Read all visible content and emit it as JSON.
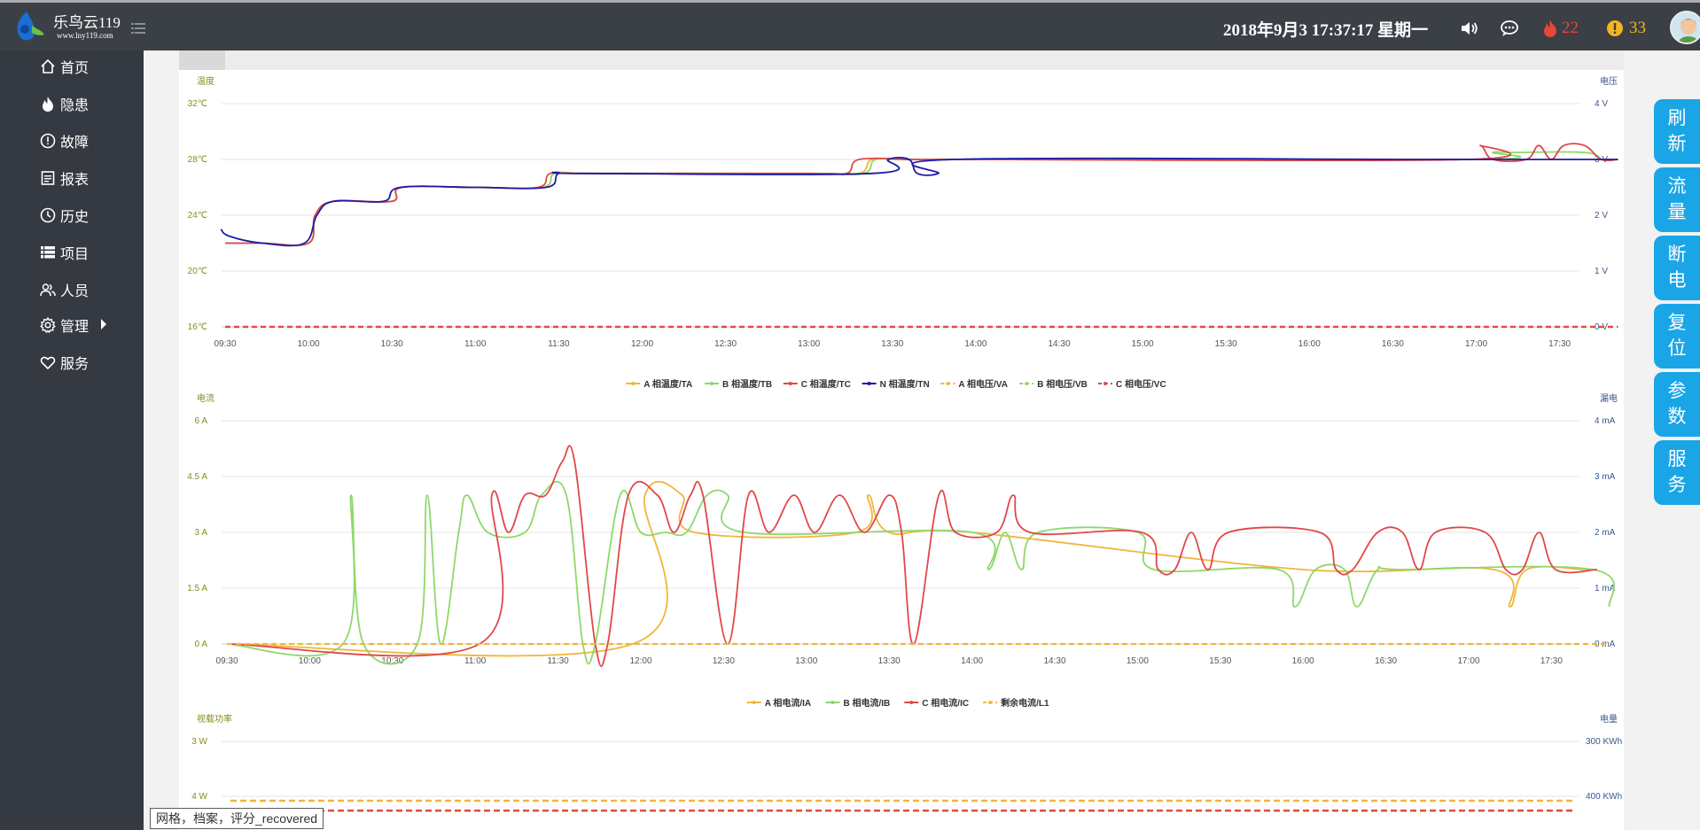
{
  "header": {
    "brand_name": "乐鸟云119",
    "brand_url": "www.lny119.com",
    "datetime": "2018年9月3 17:37:17 星期一",
    "fire_count": "22",
    "warning_count": "33"
  },
  "sidebar": {
    "items": [
      {
        "label": "首页",
        "icon": "home-icon"
      },
      {
        "label": "隐患",
        "icon": "fire-icon"
      },
      {
        "label": "故障",
        "icon": "alert-circle-icon"
      },
      {
        "label": "报表",
        "icon": "report-icon"
      },
      {
        "label": "历史",
        "icon": "clock-icon"
      },
      {
        "label": "项目",
        "icon": "project-icon"
      },
      {
        "label": "人员",
        "icon": "people-icon"
      },
      {
        "label": "管理",
        "icon": "gear-icon"
      },
      {
        "label": "服务",
        "icon": "heart-icon"
      }
    ]
  },
  "actions": [
    {
      "line1": "刷",
      "line2": "新"
    },
    {
      "line1": "流",
      "line2": "量"
    },
    {
      "line1": "断",
      "line2": "电"
    },
    {
      "line1": "复",
      "line2": "位"
    },
    {
      "line1": "参",
      "line2": "数"
    },
    {
      "line1": "服",
      "line2": "务"
    }
  ],
  "tooltip": "网格，档案，评分_recovered",
  "colors": {
    "series_a": "#f0b63a",
    "series_b": "#8fd86a",
    "series_c": "#e04848",
    "series_n": "#1f1aa6",
    "axis_left": "#8a8a20",
    "axis_right": "#3a5a8a",
    "action": "#1aa6e6"
  },
  "chart_data": [
    {
      "type": "line",
      "ylabel": "温度",
      "y2label": "电压",
      "x": [
        "09:30",
        "10:00",
        "10:30",
        "11:00",
        "11:30",
        "12:00",
        "12:30",
        "13:00",
        "13:30",
        "14:00",
        "14:30",
        "15:00",
        "15:30",
        "16:00",
        "16:30",
        "17:00",
        "17:30"
      ],
      "ylim": [
        16,
        32
      ],
      "yticks": [
        "16℃",
        "20℃",
        "24℃",
        "28℃",
        "32℃"
      ],
      "y2lim": [
        0,
        4
      ],
      "y2ticks": [
        "0 V",
        "1 V",
        "2 V",
        "3 V",
        "4 V"
      ],
      "grid": true,
      "legend_position": "bottom",
      "series": [
        {
          "name": "A 相温度/TA",
          "axis": "left",
          "color": "#f0b63a",
          "dash": false,
          "points": [
            [
              0,
              22
            ],
            [
              0.45,
              22
            ],
            [
              1,
              22
            ],
            [
              1.08,
              24
            ],
            [
              1.3,
              25
            ],
            [
              2,
              25
            ],
            [
              2.12,
              26
            ],
            [
              3,
              26
            ],
            [
              3.8,
              26
            ],
            [
              3.95,
              27
            ],
            [
              4.3,
              27
            ],
            [
              4.95,
              27
            ],
            [
              7,
              27
            ],
            [
              7.6,
              27
            ],
            [
              7.75,
              28
            ],
            [
              8.05,
              28
            ],
            [
              8.35,
              28
            ],
            [
              9,
              28
            ],
            [
              15,
              28
            ]
          ]
        },
        {
          "name": "B 相温度/TB",
          "axis": "left",
          "color": "#8fd86a",
          "dash": false,
          "points": [
            [
              0,
              22
            ],
            [
              0.45,
              22
            ],
            [
              1,
              22
            ],
            [
              1.08,
              24
            ],
            [
              1.3,
              25
            ],
            [
              2,
              25
            ],
            [
              2.12,
              26
            ],
            [
              3,
              26
            ],
            [
              3.8,
              26
            ],
            [
              3.95,
              27
            ],
            [
              4.3,
              27
            ],
            [
              7,
              27
            ],
            [
              7.65,
              27
            ],
            [
              7.8,
              28
            ],
            [
              8.2,
              28
            ],
            [
              8.35,
              28
            ],
            [
              9,
              28
            ],
            [
              15,
              28
            ],
            [
              15.2,
              28.5
            ],
            [
              15.45,
              28.5
            ],
            [
              16.3,
              28.5
            ],
            [
              16.5,
              28
            ]
          ]
        },
        {
          "name": "C 相温度/TC",
          "axis": "left",
          "color": "#e04848",
          "dash": false,
          "points": [
            [
              0,
              22
            ],
            [
              0.45,
              22
            ],
            [
              1,
              22
            ],
            [
              1.08,
              24
            ],
            [
              1.3,
              25
            ],
            [
              2,
              25
            ],
            [
              2.12,
              26
            ],
            [
              3,
              26
            ],
            [
              3.75,
              26
            ],
            [
              3.9,
              27
            ],
            [
              4.3,
              27
            ],
            [
              7,
              27
            ],
            [
              7.45,
              27
            ],
            [
              7.6,
              28
            ],
            [
              8.2,
              28
            ],
            [
              8.45,
              28
            ],
            [
              9,
              28
            ],
            [
              14.9,
              28
            ],
            [
              15.05,
              29
            ],
            [
              15.2,
              28
            ],
            [
              15.6,
              28
            ],
            [
              15.75,
              29
            ],
            [
              15.9,
              28
            ],
            [
              16.05,
              29
            ],
            [
              16.3,
              29
            ],
            [
              16.5,
              28
            ],
            [
              16.7,
              28
            ]
          ]
        },
        {
          "name": "N 相温度/TN",
          "axis": "left",
          "color": "#1f1aa6",
          "dash": false,
          "points": [
            [
              -0.05,
              23
            ],
            [
              0.05,
              22.5
            ],
            [
              0.45,
              22
            ],
            [
              0.95,
              22
            ],
            [
              1.1,
              24
            ],
            [
              1.3,
              25
            ],
            [
              1.9,
              25
            ],
            [
              2.1,
              26
            ],
            [
              3,
              26
            ],
            [
              3.85,
              26
            ],
            [
              4,
              27
            ],
            [
              4.3,
              27
            ],
            [
              7.75,
              27
            ],
            [
              7.95,
              28
            ],
            [
              8.2,
              28
            ],
            [
              8.3,
              27
            ],
            [
              8.55,
              27
            ],
            [
              8.75,
              28
            ],
            [
              14.5,
              28
            ],
            [
              16.7,
              28
            ]
          ]
        },
        {
          "name": "A 相电压/VA",
          "axis": "right",
          "color": "#f0b63a",
          "dash": true,
          "points": [
            [
              0,
              0
            ],
            [
              16.7,
              0
            ]
          ]
        },
        {
          "name": "B 相电压/VB",
          "axis": "right",
          "color": "#8fd86a",
          "dash": true,
          "points": [
            [
              0,
              0
            ],
            [
              16.7,
              0
            ]
          ]
        },
        {
          "name": "C 相电压/VC",
          "axis": "right",
          "color": "#e04848",
          "dash": true,
          "points": [
            [
              0,
              0
            ],
            [
              16.7,
              0
            ]
          ]
        }
      ]
    },
    {
      "type": "line",
      "ylabel": "电流",
      "y2label": "漏电",
      "x": [
        "09:30",
        "10:00",
        "10:30",
        "11:00",
        "11:30",
        "12:00",
        "12:30",
        "13:00",
        "13:30",
        "14:00",
        "14:30",
        "15:00",
        "15:30",
        "16:00",
        "16:30",
        "17:00",
        "17:30"
      ],
      "ylim": [
        0,
        6
      ],
      "yticks": [
        "0 A",
        "1.5 A",
        "3 A",
        "4.5 A",
        "6 A"
      ],
      "y2lim": [
        0,
        4
      ],
      "y2ticks": [
        "0 mA",
        "1 mA",
        "2 mA",
        "3 mA",
        "4 mA"
      ],
      "grid": true,
      "legend_position": "bottom",
      "series": [
        {
          "name": "A 相电流/IA",
          "axis": "left",
          "color": "#f0b63a",
          "dash": false,
          "points": [
            [
              0,
              0
            ],
            [
              4.9,
              0
            ],
            [
              5.05,
              4
            ],
            [
              5.5,
              4
            ],
            [
              5.65,
              3
            ],
            [
              7.6,
              3
            ],
            [
              7.75,
              4
            ],
            [
              8,
              3
            ],
            [
              9,
              3
            ],
            [
              13,
              2
            ],
            [
              15.3,
              2
            ],
            [
              15.5,
              1
            ],
            [
              15.7,
              2
            ],
            [
              16.4,
              2
            ],
            [
              16.55,
              2
            ]
          ]
        },
        {
          "name": "B 相电流/IB",
          "axis": "left",
          "color": "#8fd86a",
          "dash": false,
          "points": [
            [
              0,
              0
            ],
            [
              1.4,
              0
            ],
            [
              1.5,
              4
            ],
            [
              1.65,
              0
            ],
            [
              2.3,
              0
            ],
            [
              2.42,
              4
            ],
            [
              2.58,
              0
            ],
            [
              2.8,
              3
            ],
            [
              2.9,
              4
            ],
            [
              3.15,
              3
            ],
            [
              3.6,
              3
            ],
            [
              3.8,
              4
            ],
            [
              4.1,
              4
            ],
            [
              4.3,
              0
            ],
            [
              4.45,
              0
            ],
            [
              4.75,
              4
            ],
            [
              5,
              3
            ],
            [
              5.3,
              3
            ],
            [
              5.55,
              3
            ],
            [
              5.8,
              4
            ],
            [
              6.05,
              4
            ],
            [
              6.25,
              3
            ],
            [
              9,
              3
            ],
            [
              9.2,
              2
            ],
            [
              9.4,
              3
            ],
            [
              9.6,
              2
            ],
            [
              9.8,
              3
            ],
            [
              11,
              3
            ],
            [
              11.2,
              2
            ],
            [
              12.7,
              2
            ],
            [
              12.9,
              1
            ],
            [
              13.15,
              2
            ],
            [
              13.5,
              2
            ],
            [
              13.65,
              1
            ],
            [
              13.9,
              2
            ],
            [
              14.2,
              2
            ],
            [
              16.5,
              2
            ],
            [
              16.7,
              1
            ]
          ]
        },
        {
          "name": "C 相电流/IC",
          "axis": "left",
          "color": "#e04848",
          "dash": false,
          "points": [
            [
              0,
              0
            ],
            [
              3.05,
              0
            ],
            [
              3.2,
              4
            ],
            [
              3.4,
              3
            ],
            [
              3.6,
              4
            ],
            [
              3.85,
              4
            ],
            [
              4.05,
              4.9
            ],
            [
              4.2,
              4.9
            ],
            [
              4.45,
              0
            ],
            [
              4.6,
              0
            ],
            [
              4.85,
              4
            ],
            [
              5.2,
              4
            ],
            [
              5.4,
              3
            ],
            [
              5.6,
              4
            ],
            [
              5.75,
              4
            ],
            [
              6.05,
              0
            ],
            [
              6.3,
              4
            ],
            [
              6.55,
              3
            ],
            [
              6.85,
              4
            ],
            [
              7.1,
              3
            ],
            [
              7.4,
              4
            ],
            [
              7.7,
              3
            ],
            [
              8,
              4
            ],
            [
              8.15,
              3
            ],
            [
              8.3,
              0
            ],
            [
              8.6,
              4
            ],
            [
              8.8,
              3
            ],
            [
              9.3,
              3
            ],
            [
              9.5,
              4
            ],
            [
              9.7,
              3
            ],
            [
              11.05,
              3
            ],
            [
              11.25,
              2
            ],
            [
              11.45,
              2
            ],
            [
              11.65,
              3
            ],
            [
              11.85,
              2
            ],
            [
              12.1,
              3
            ],
            [
              13.2,
              3
            ],
            [
              13.4,
              2
            ],
            [
              13.6,
              2
            ],
            [
              13.9,
              3
            ],
            [
              14.2,
              3
            ],
            [
              14.4,
              2
            ],
            [
              14.6,
              3
            ],
            [
              15.2,
              3
            ],
            [
              15.45,
              2
            ],
            [
              15.65,
              2
            ],
            [
              15.85,
              3
            ],
            [
              16.05,
              2
            ],
            [
              16.55,
              2
            ]
          ]
        },
        {
          "name": "剩余电流/L1",
          "axis": "right",
          "color": "#f0b63a",
          "dash": true,
          "points": [
            [
              0,
              0
            ],
            [
              16.7,
              0
            ]
          ]
        }
      ]
    },
    {
      "type": "line",
      "ylabel": "视载功率",
      "y2label": "电量",
      "yticks": [
        "3 W",
        "4 W"
      ],
      "y2ticks": [
        "300 KWh",
        "400 KWh"
      ],
      "grid": true,
      "series": [
        {
          "name": "",
          "axis": "left",
          "color": "#f0b63a",
          "dash": true,
          "value": 2.92
        },
        {
          "name": "",
          "axis": "left",
          "color": "#e04848",
          "dash": true,
          "value": 2.74
        }
      ]
    }
  ]
}
